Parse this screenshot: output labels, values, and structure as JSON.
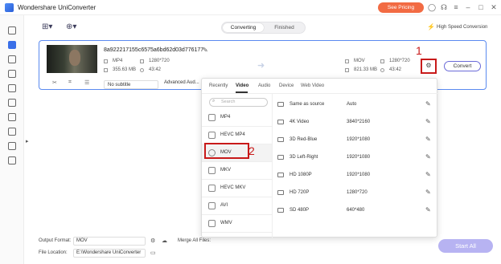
{
  "app": {
    "title": "Wondershare UniConverter",
    "pricing_label": "See Pricing"
  },
  "tabs": [
    {
      "label": "Converting",
      "active": true
    },
    {
      "label": "Finished",
      "active": false
    }
  ],
  "high_speed": {
    "label": "High Speed Conversion"
  },
  "file": {
    "name": "8a922217155c6575a6bd62d03d776177",
    "source": {
      "format": "MP4",
      "resolution": "1280*720",
      "size": "355.63 MB",
      "duration": "43:42"
    },
    "target": {
      "format": "MOV",
      "resolution": "1280*720",
      "size": "821.33 MB",
      "duration": "43:42"
    },
    "subtitle": "No subtitle",
    "audio": "Advanced Aud...",
    "convert_label": "Convert"
  },
  "annotations": {
    "step1": "1",
    "step2": "2",
    "color": "#c81a1a"
  },
  "dropdown": {
    "tabs": [
      "Recently",
      "Video",
      "Audio",
      "Device",
      "Web Video"
    ],
    "active_tab": "Video",
    "search_placeholder": "Search",
    "formats": [
      "MP4",
      "HEVC MP4",
      "MOV",
      "MKV",
      "HEVC MKV",
      "AVI",
      "WMV"
    ],
    "selected_format": "MOV",
    "qualities": [
      {
        "name": "Same as source",
        "resolution": "Auto"
      },
      {
        "name": "4K Video",
        "resolution": "3840*2160"
      },
      {
        "name": "3D Red-Blue",
        "resolution": "1920*1080"
      },
      {
        "name": "3D Left-Right",
        "resolution": "1920*1080"
      },
      {
        "name": "HD 1080P",
        "resolution": "1920*1080"
      },
      {
        "name": "HD 720P",
        "resolution": "1280*720"
      },
      {
        "name": "SD 480P",
        "resolution": "640*480"
      }
    ]
  },
  "bottom": {
    "output_format_label": "Output Format:",
    "output_format_value": "MOV",
    "merge_label": "Merge All Files:",
    "file_location_label": "File Location:",
    "file_location_value": "E:\\Wondershare UniConverter",
    "start_all_label": "Start All"
  },
  "colors": {
    "accent": "#3a6fe8",
    "pricing": "#f26b43",
    "start_all": "#b7b3f2"
  }
}
